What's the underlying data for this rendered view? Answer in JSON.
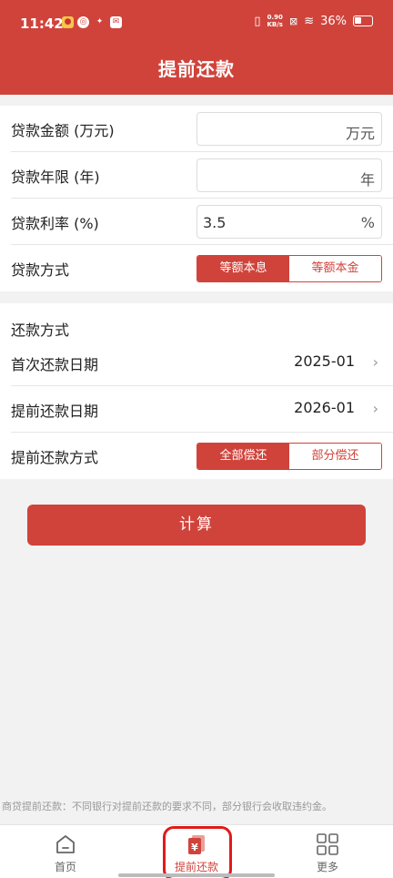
{
  "status_bar": {
    "time": "11:42",
    "net_speed_top": "0.90",
    "net_speed_bottom": "KB/s",
    "battery": "36%"
  },
  "header": {
    "title": "提前还款"
  },
  "loan": {
    "amount_label": "贷款金额 (万元)",
    "amount_value": "",
    "amount_unit": "万元",
    "years_label": "贷款年限 (年)",
    "years_value": "",
    "years_unit": "年",
    "rate_label": "贷款利率 (%)",
    "rate_value": "3.5",
    "rate_unit": "%",
    "method_label": "贷款方式",
    "method_options": [
      "等额本息",
      "等额本金"
    ],
    "method_selected": "等额本息"
  },
  "repay": {
    "section_title": "还款方式",
    "first_date_label": "首次还款日期",
    "first_date_value": "2025-01",
    "prepay_date_label": "提前还款日期",
    "prepay_date_value": "2026-01",
    "prepay_method_label": "提前还款方式",
    "prepay_options": [
      "全部偿还",
      "部分偿还"
    ],
    "prepay_selected": "全部偿还"
  },
  "calculate_label": "计算",
  "note": "商贷提前还款：不同银行对提前还款的要求不同，部分银行会收取违约金。",
  "tabs": [
    {
      "label": "首页",
      "icon": "home-icon"
    },
    {
      "label": "提前还款",
      "icon": "yuan-icon"
    },
    {
      "label": "更多",
      "icon": "grid-icon"
    }
  ],
  "colors": {
    "accent": "#d0433b",
    "highlight_box": "#e01a1a"
  }
}
